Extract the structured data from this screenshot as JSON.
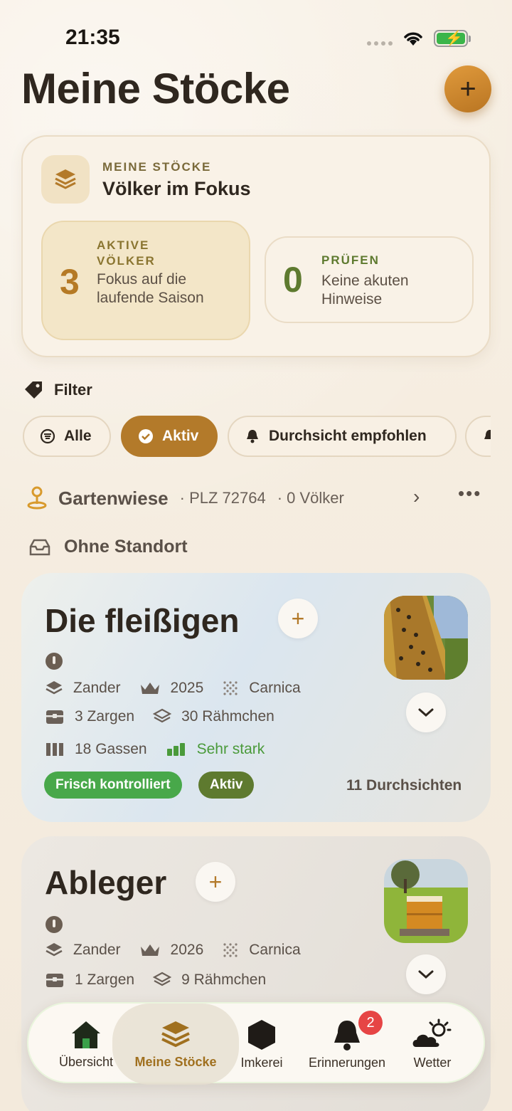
{
  "status": {
    "time": "21:35"
  },
  "header": {
    "title": "Meine Stöcke",
    "add_label": "+"
  },
  "summary": {
    "eyebrow": "MEINE STÖCKE",
    "title": "Völker im Fokus",
    "active": {
      "value": "3",
      "label": "AKTIVE VÖLKER",
      "desc": "Fokus auf die laufende Saison"
    },
    "check": {
      "value": "0",
      "label": "PRÜFEN",
      "desc": "Keine akuten Hinweise"
    }
  },
  "filter": {
    "label": "Filter",
    "chips": [
      {
        "label": "Alle",
        "active": false
      },
      {
        "label": "Aktiv",
        "active": true
      },
      {
        "label": "Durchsicht empfohlen",
        "active": false
      }
    ]
  },
  "location": {
    "name": "Gartenwiese",
    "plz": "· PLZ 72764",
    "count": "· 0 Völker"
  },
  "no_location": {
    "label": "Ohne Standort"
  },
  "hives": [
    {
      "name": "Die fleißigen",
      "frame_type": "Zander",
      "queen_year": "2025",
      "breed": "Carnica",
      "boxes": "3 Zargen",
      "frames": "30 Rähmchen",
      "gaps": "18 Gassen",
      "strength": "Sehr stark",
      "badges": [
        "Frisch kontrolliert",
        "Aktiv"
      ],
      "inspections": "11 Durchsichten"
    },
    {
      "name": "Ableger",
      "frame_type": "Zander",
      "queen_year": "2026",
      "breed": "Carnica",
      "boxes": "1 Zargen",
      "frames": "9 Rähmchen"
    }
  ],
  "tabbar": {
    "items": [
      {
        "label": "Übersicht",
        "icon": "house-icon"
      },
      {
        "label": "Meine Stöcke",
        "icon": "stack-icon"
      },
      {
        "label": "Imkerei",
        "icon": "hexagon-icon"
      },
      {
        "label": "Erinnerungen",
        "icon": "bell-icon",
        "badge": "2"
      },
      {
        "label": "Wetter",
        "icon": "weather-icon"
      }
    ]
  },
  "colors": {
    "accent": "#b37a2a",
    "green": "#48a84a",
    "olive": "#5e7a2f",
    "background": "#f6eee2"
  }
}
